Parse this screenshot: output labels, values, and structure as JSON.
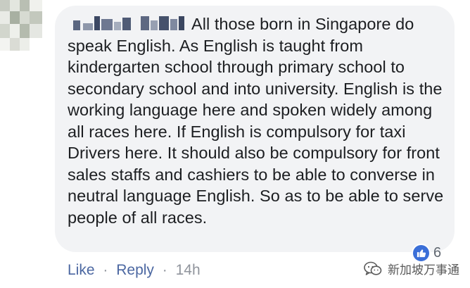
{
  "comment": {
    "author_name": "",
    "text": "All those born in Singapore do speak English. As English is taught from kindergarten school through primary school to secondary school and into university. English is the working language here and spoken widely among all races here. If English is compulsory for taxi Drivers here. It should also be compulsory for front sales staffs and cashiers to be able to converse in neutral language English. So as to be able to serve people of all races.",
    "reaction": {
      "icon": "thumbs-up-icon",
      "count": "6",
      "color": "#3b6fd8"
    }
  },
  "actions": {
    "like_label": "Like",
    "separator": "·",
    "reply_label": "Reply",
    "timestamp": "14h"
  },
  "watermark": {
    "icon": "wechat-logo-icon",
    "text": "新加坡万事通"
  },
  "colors": {
    "bubble": "#f2f3f5",
    "text": "#1c1e21",
    "link": "#4b67a1",
    "muted": "#90949c"
  }
}
